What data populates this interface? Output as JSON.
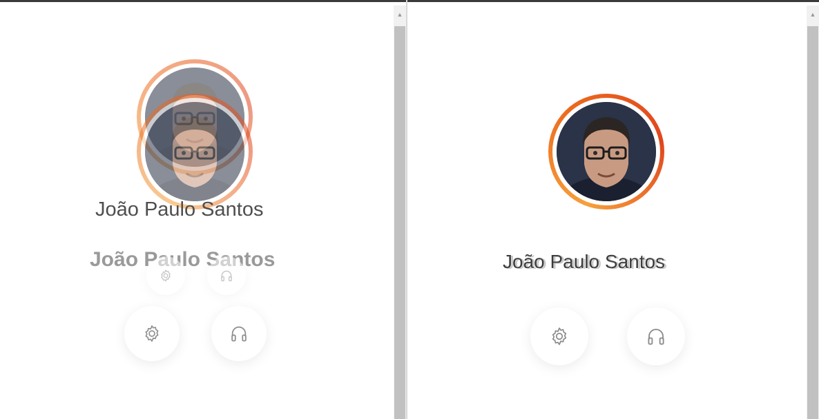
{
  "profile": {
    "name": "João Paulo Santos"
  },
  "actions": {
    "settings_icon": "gear-icon",
    "support_icon": "headphones-icon"
  },
  "colors": {
    "ring_start": "#f6a03c",
    "ring_mid": "#ec6a1e",
    "ring_end": "#e0461f",
    "text": "#3b3b3b",
    "icon": "#8d8d8d"
  }
}
